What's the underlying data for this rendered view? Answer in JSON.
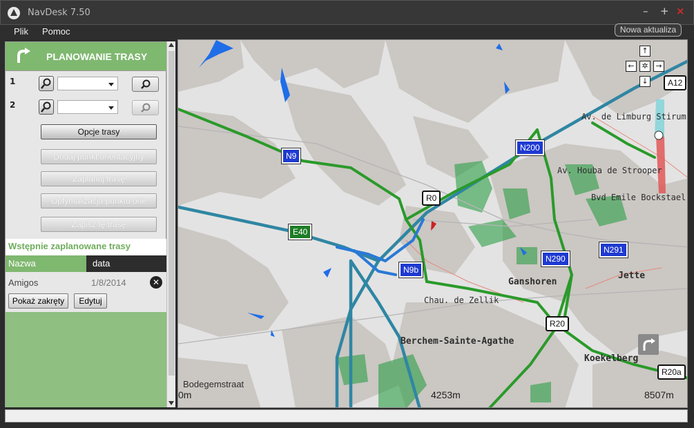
{
  "window": {
    "title": "NavDesk 7.50",
    "minimize": "–",
    "maximize": "+",
    "close": "×"
  },
  "menu": {
    "file": "Plik",
    "help": "Pomoc",
    "update": "Nowa  aktualiza"
  },
  "planner": {
    "title": "PLANOWANIE TRASY",
    "waypoints": [
      {
        "num": "1"
      },
      {
        "num": "2"
      }
    ],
    "buttons": {
      "route_options": "Opcje trasy",
      "add_landmark": "Dodaj punkt orientacyjny",
      "plan_route": "Zaplanuj trasę",
      "optimize": "Optymalizacja  punktu orie",
      "save_route": "Zapisz tę trasę"
    }
  },
  "saved_routes": {
    "title": "Wstępnie zaplanowane trasy",
    "columns": {
      "name": "Nazwa",
      "date": "data"
    },
    "items": [
      {
        "name": "Amigos",
        "date": "1/8/2014",
        "show_turns": "Pokaż zakręty",
        "edit": "Edytuj"
      }
    ]
  },
  "map": {
    "labels": {
      "limburg": "Av. de Limburg Stirum",
      "houba": "Av. Houba de Strooper",
      "bockstael": "Bvd Emile Bockstael",
      "ganshoren": "Ganshoren",
      "jette": "Jette",
      "zellik": "Chau. de Zellik",
      "berchem": "Berchem-Sainte-Agathe",
      "koekelberg": "Koekelberg",
      "bodegem": "Bodegemstraat"
    },
    "signs": {
      "n9": "N9",
      "n200": "N200",
      "e40": "E40",
      "r0": "R0",
      "n9b": "N9b",
      "n290": "N290",
      "n291": "N291",
      "r20": "R20",
      "r20a": "R20a",
      "a12": "A12"
    },
    "scale": {
      "s0": "0m",
      "s1": "4253m",
      "s2": "8507m"
    },
    "colors": {
      "motorway": "#2f86a3",
      "primary": "#2a9a2a",
      "route": "#2c7be5",
      "built": "#c9c6c2",
      "water": "#1f6ee8"
    }
  }
}
